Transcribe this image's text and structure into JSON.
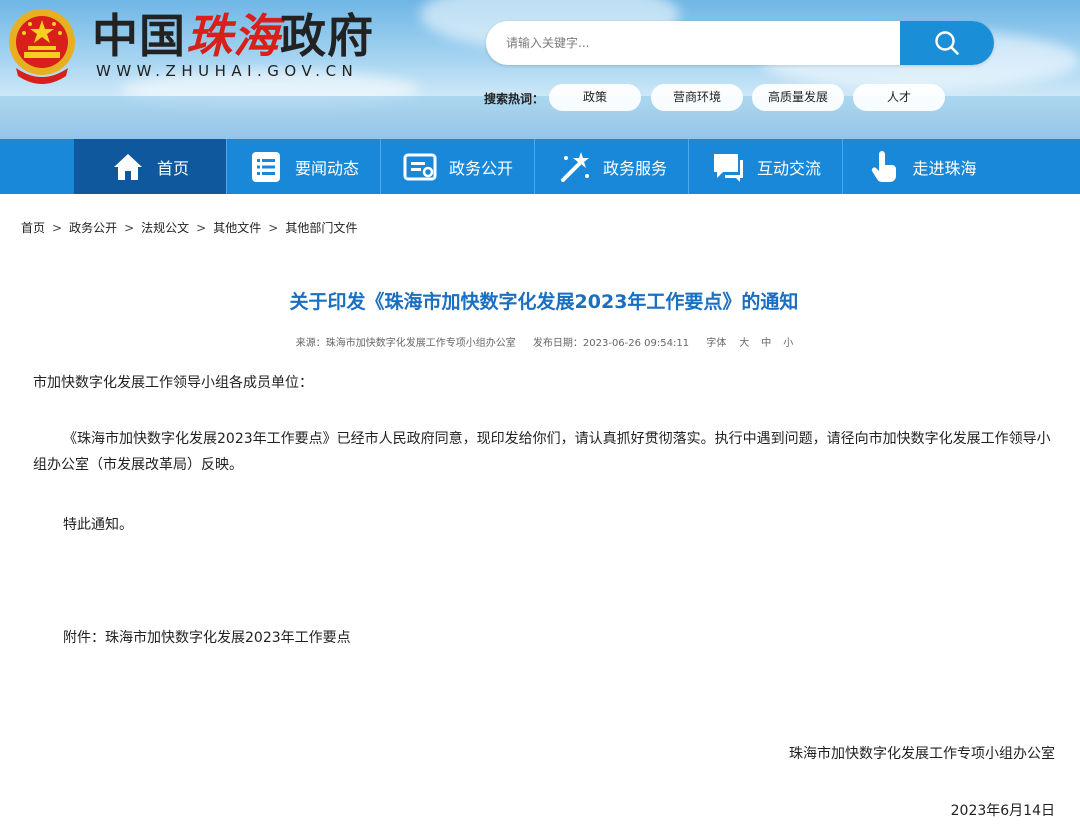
{
  "header": {
    "site_name_part1": "中国",
    "site_name_part2": "珠海",
    "site_name_part3": "政府",
    "site_url": "WWW.ZHUHAI.GOV.CN",
    "search": {
      "placeholder": "请输入关键字...",
      "button_icon": "search-icon"
    },
    "hot_search_label": "搜索热词：",
    "hot_tags": [
      "政策",
      "营商环境",
      "高质量发展",
      "人才"
    ]
  },
  "nav": {
    "items": [
      {
        "label": "首页",
        "icon": "home-icon",
        "active": true
      },
      {
        "label": "要闻动态",
        "icon": "news-list-icon"
      },
      {
        "label": "政务公开",
        "icon": "document-icon"
      },
      {
        "label": "政务服务",
        "icon": "magic-wand-icon"
      },
      {
        "label": "互动交流",
        "icon": "chat-bubble-icon"
      },
      {
        "label": "走进珠海",
        "icon": "pointer-hand-icon"
      }
    ],
    "color": "#1a88d8",
    "active_color": "#10589e"
  },
  "breadcrumb": [
    "首页",
    "政务公开",
    "法规公文",
    "其他文件",
    "其他部门文件"
  ],
  "article": {
    "title": "关于印发《珠海市加快数字化发展2023年工作要点》的通知",
    "source": "来源：珠海市加快数字化发展工作专项小组办公室",
    "publish_date": "发布日期：2023-06-26 09:54:11",
    "font_label": "字体",
    "font_sizes": [
      "大",
      "中",
      "小"
    ],
    "salutation": "市加快数字化发展工作领导小组各成员单位：",
    "body": "《珠海市加快数字化发展2023年工作要点》已经市人民政府同意，现印发给你们，请认真抓好贯彻落实。执行中遇到问题，请径向市加快数字化发展工作领导小组办公室（市发展改革局）反映。",
    "notice": "特此通知。",
    "attachment": "附件：珠海市加快数字化发展2023年工作要点",
    "signature_org": "珠海市加快数字化发展工作专项小组办公室",
    "signature_date": "2023年6月14日",
    "title_color": "#1a6fc0"
  }
}
